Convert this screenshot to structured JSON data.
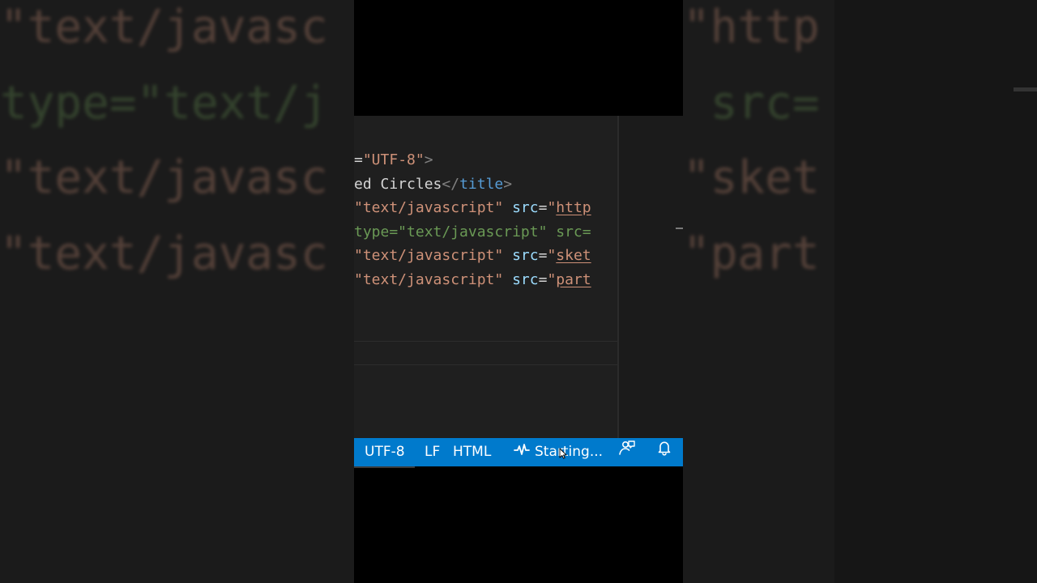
{
  "editor": {
    "lines": [
      [
        {
          "t": "=",
          "c": "tok-text"
        },
        {
          "t": "\"UTF-8\"",
          "c": "tok-str"
        },
        {
          "t": ">",
          "c": "tok-bracket"
        }
      ],
      [
        {
          "t": "ed Circles",
          "c": "tok-text"
        },
        {
          "t": "</",
          "c": "tok-bracket"
        },
        {
          "t": "title",
          "c": "tok-tag"
        },
        {
          "t": ">",
          "c": "tok-bracket"
        }
      ],
      [
        {
          "t": "\"text/javascript\"",
          "c": "tok-str"
        },
        {
          "t": " src",
          "c": "tok-attr"
        },
        {
          "t": "=",
          "c": "tok-text"
        },
        {
          "t": "\"",
          "c": "tok-str"
        },
        {
          "t": "http",
          "c": "tok-link"
        }
      ],
      [
        {
          "t": "type=\"text/javascript\" src=",
          "c": "tok-comment"
        }
      ],
      [
        {
          "t": "\"text/javascript\"",
          "c": "tok-str"
        },
        {
          "t": " src",
          "c": "tok-attr"
        },
        {
          "t": "=",
          "c": "tok-text"
        },
        {
          "t": "\"",
          "c": "tok-str"
        },
        {
          "t": "sket",
          "c": "tok-link"
        }
      ],
      [
        {
          "t": "\"text/javascript\"",
          "c": "tok-str"
        },
        {
          "t": " src",
          "c": "tok-attr"
        },
        {
          "t": "=",
          "c": "tok-text"
        },
        {
          "t": "\"",
          "c": "tok-str"
        },
        {
          "t": "part",
          "c": "tok-link"
        }
      ]
    ]
  },
  "background": {
    "left_lines": [
      {
        "text": "\"text/javasc",
        "color": "#ce9178"
      },
      {
        "text": "type=\"text/j",
        "color": "#6a9955"
      },
      {
        "text": "\"text/javasc",
        "color": "#ce9178"
      },
      {
        "text": "\"text/javasc",
        "color": "#ce9178"
      }
    ],
    "right_lines": [
      {
        "text": "\"http",
        "color": "#ce9178"
      },
      {
        "text": " src=",
        "color": "#6a9955"
      },
      {
        "text": "\"sket",
        "color": "#ce9178"
      },
      {
        "text": "\"part",
        "color": "#ce9178"
      }
    ]
  },
  "status_bar": {
    "encoding": "UTF-8",
    "eol": "LF",
    "language": "HTML",
    "live_server": "Starting...",
    "live_icon": "pulse-icon",
    "feedback_icon": "feedback-icon",
    "bell_icon": "bell-icon"
  },
  "colors": {
    "status_bar": "#007acc",
    "editor_bg": "#1f1f1f",
    "string": "#ce9178",
    "tag": "#569cd6",
    "comment": "#6a9955",
    "attribute": "#9cdcfe"
  }
}
